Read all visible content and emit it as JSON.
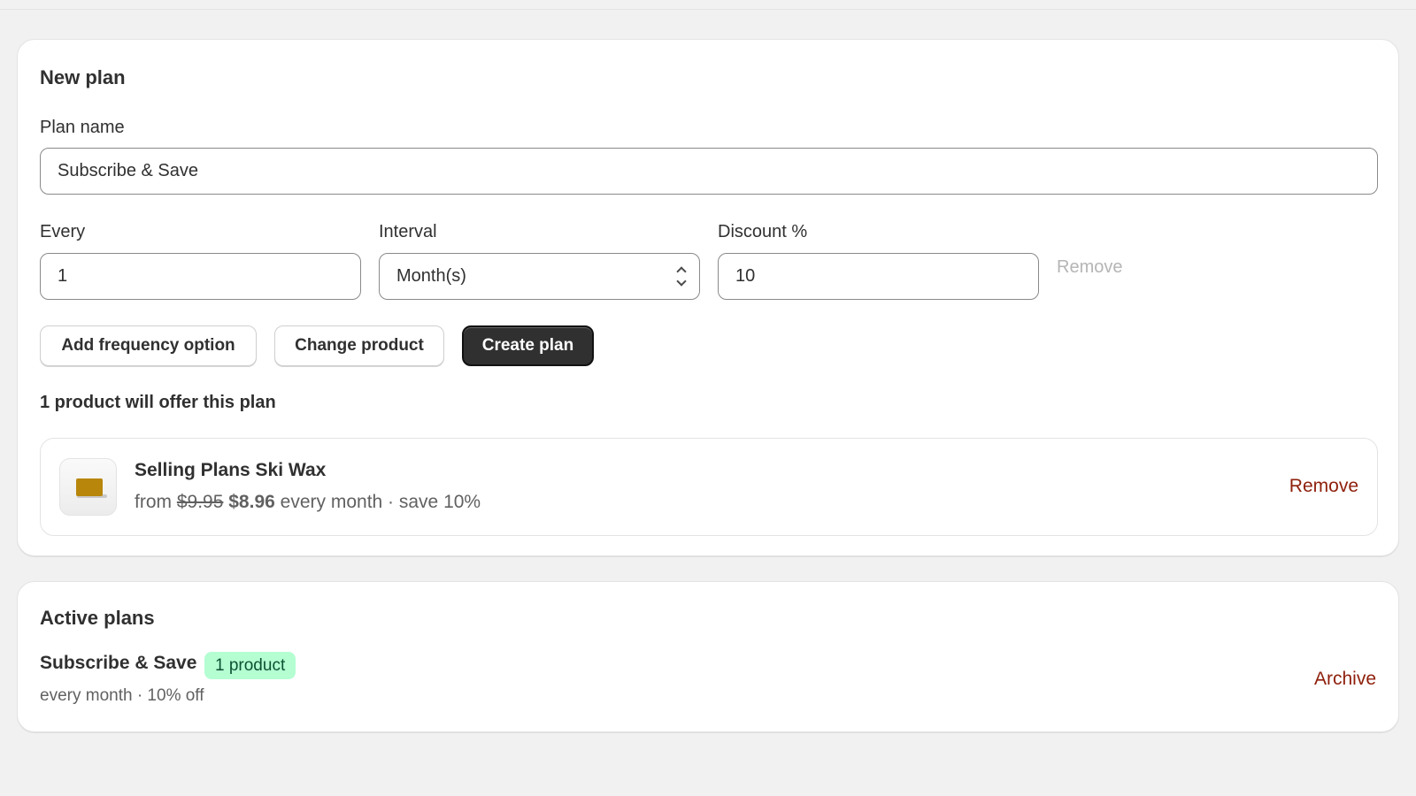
{
  "new_plan": {
    "title": "New plan",
    "plan_name_label": "Plan name",
    "plan_name_value": "Subscribe & Save",
    "every_label": "Every",
    "every_value": "1",
    "interval_label": "Interval",
    "interval_value": "Month(s)",
    "discount_label": "Discount %",
    "discount_value": "10",
    "remove_label": "Remove",
    "buttons": {
      "add_frequency": "Add frequency option",
      "change_product": "Change product",
      "create_plan": "Create plan"
    },
    "products_heading": "1 product will offer this plan",
    "product": {
      "name": "Selling Plans Ski Wax",
      "from": "from",
      "old_price": "$9.95",
      "new_price": "$8.96",
      "suffix": "every month · save 10%",
      "remove_label": "Remove",
      "thumbnail_icon": "ski-wax-image"
    }
  },
  "active_plans": {
    "title": "Active plans",
    "plans": [
      {
        "name": "Subscribe & Save",
        "badge": "1 product",
        "detail": "every month · 10% off",
        "archive_label": "Archive"
      }
    ]
  },
  "colors": {
    "background": "#f1f1f1",
    "primary_button": "#303030",
    "critical_link": "#8e1f0b",
    "success_badge_bg": "#b4fed2",
    "success_badge_text": "#0c5132"
  }
}
